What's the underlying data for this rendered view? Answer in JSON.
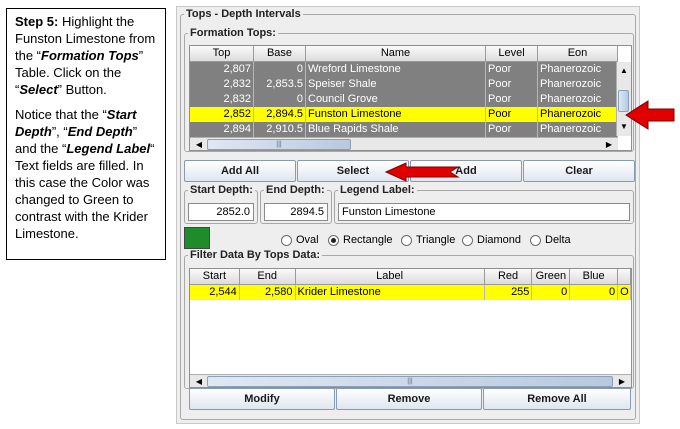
{
  "note": {
    "step_label": "Step 5:",
    "p1_a": " Highlight the Funston Limestone from the “",
    "p1_b": "Formation Tops",
    "p1_c": "” Table. Click  on the “",
    "p1_d": "Select",
    "p1_e": "” Button.",
    "p2_a": "Notice that the “",
    "p2_b": "Start Depth",
    "p2_c": "”, “",
    "p2_d": "End Depth",
    "p2_e": "” and the “",
    "p2_f": "Legend Label",
    "p2_g": "“ Text fields are filled.  In this case the Color was changed to Green to contrast with the Krider Limestone."
  },
  "panel": {
    "title": "Tops - Depth Intervals"
  },
  "formation_tops": {
    "title": "Formation Tops:",
    "columns": [
      "Top",
      "Base",
      "Name",
      "Level",
      "Eon"
    ],
    "rows": [
      {
        "top": "2,807",
        "base": "0",
        "name": "Wreford Limestone",
        "level": "Poor",
        "eon": "Phanerozoic",
        "state": "gray"
      },
      {
        "top": "2,832",
        "base": "2,853.5",
        "name": "Speiser Shale",
        "level": "Poor",
        "eon": "Phanerozoic",
        "state": "gray"
      },
      {
        "top": "2,832",
        "base": "0",
        "name": "Council Grove",
        "level": "Poor",
        "eon": "Phanerozoic",
        "state": "gray"
      },
      {
        "top": "2,852",
        "base": "2,894.5",
        "name": "Funston Limestone",
        "level": "Poor",
        "eon": "Phanerozoic",
        "state": "selected"
      },
      {
        "top": "2,894",
        "base": "2,910.5",
        "name": "Blue Rapids Shale",
        "level": "Poor",
        "eon": "Phanerozoic",
        "state": "gray"
      }
    ]
  },
  "buttons_top": {
    "add_all": "Add All",
    "select": "Select",
    "add": "Add",
    "clear": "Clear"
  },
  "start_depth": {
    "label": "Start Depth:",
    "value": "2852.0"
  },
  "end_depth": {
    "label": "End Depth:",
    "value": "2894.5"
  },
  "legend_label": {
    "label": "Legend Label:",
    "value": "Funston Limestone"
  },
  "color": {
    "swatch": "#1e8c2a",
    "selected": "#ffff00",
    "gray": "#808080",
    "arrow": "#e00000"
  },
  "shapes": [
    {
      "label": "Oval",
      "checked": false
    },
    {
      "label": "Rectangle",
      "checked": true
    },
    {
      "label": "Triangle",
      "checked": false
    },
    {
      "label": "Diamond",
      "checked": false
    },
    {
      "label": "Delta",
      "checked": false
    }
  ],
  "filter": {
    "title": "Filter Data By Tops Data:",
    "columns": [
      "Start",
      "End",
      "Label",
      "Red",
      "Green",
      "Blue"
    ],
    "rows": [
      {
        "start": "2,544",
        "end": "2,580",
        "label": "Krider Limestone",
        "red": "255",
        "green": "0",
        "blue": "0",
        "extra": "O"
      }
    ]
  },
  "buttons_bottom": {
    "modify": "Modify",
    "remove": "Remove",
    "remove_all": "Remove All"
  },
  "icons": {
    "up": "▲",
    "down": "▼",
    "left": "◀",
    "right": "▶",
    "grip": "|||"
  }
}
